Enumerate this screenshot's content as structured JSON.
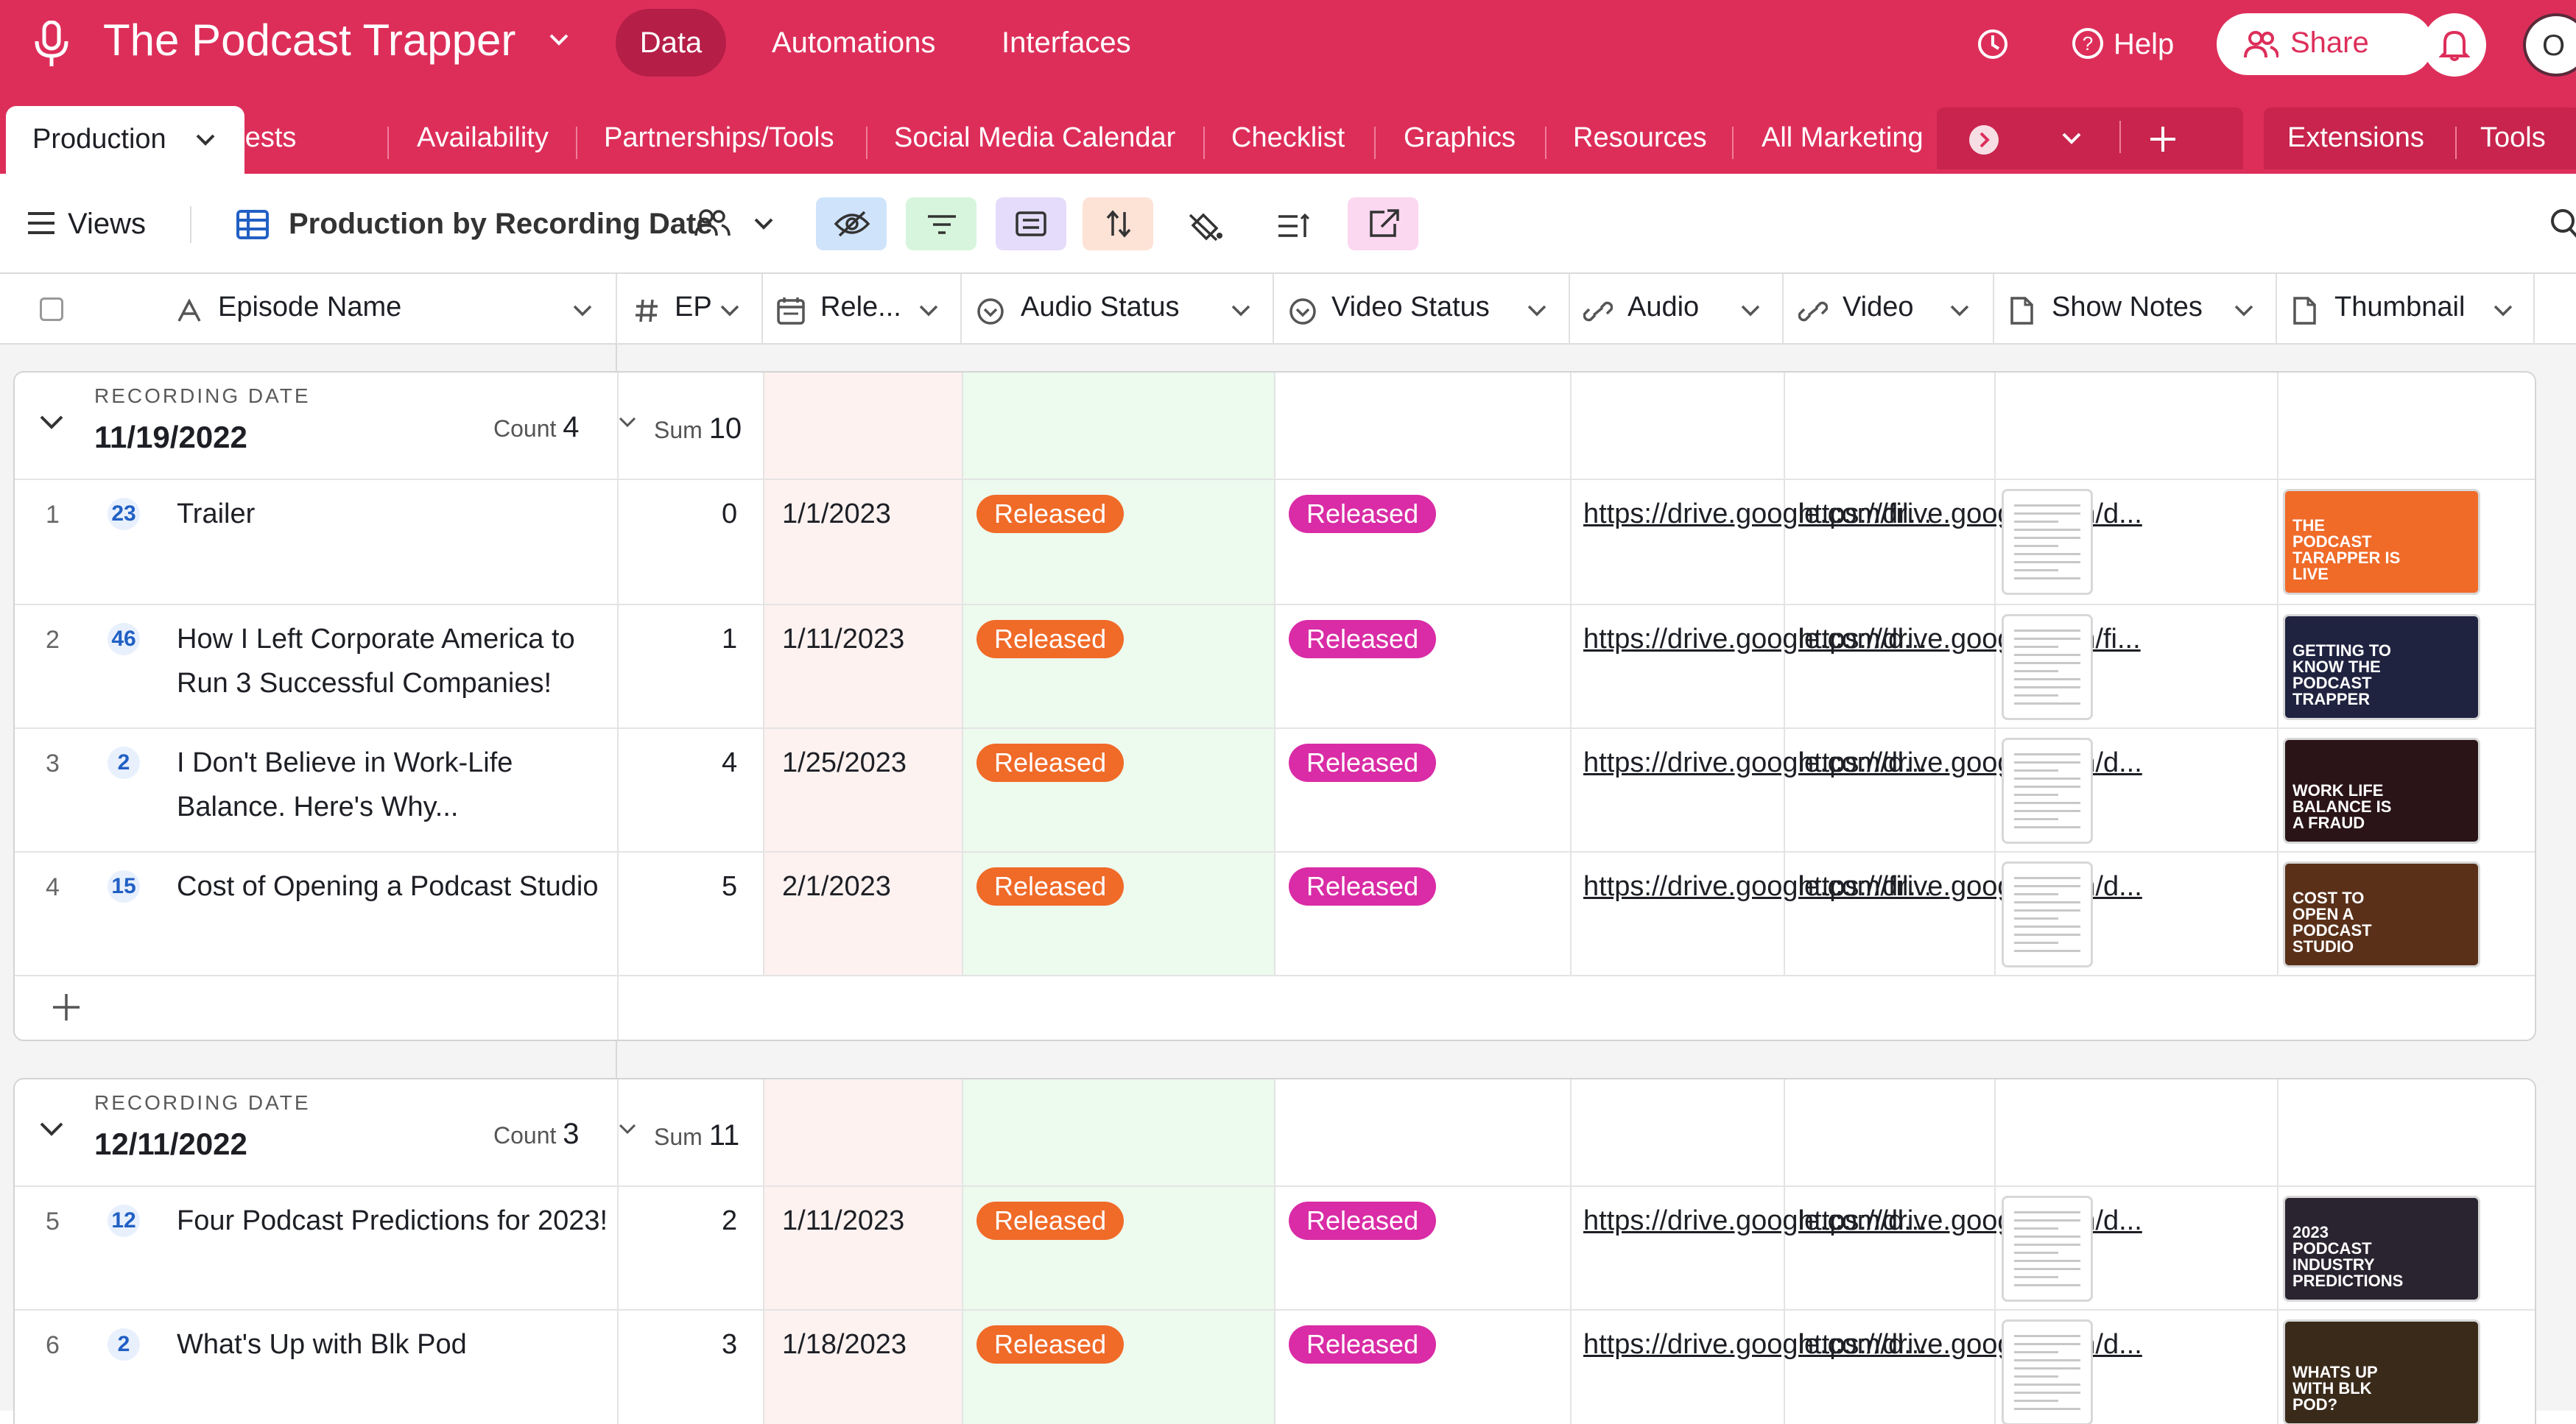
{
  "app": {
    "title": "The Podcast Trapper",
    "nav": [
      "Data",
      "Automations",
      "Interfaces"
    ],
    "help_label": "Help",
    "share_label": "Share",
    "avatar_initial": "O"
  },
  "tabs": [
    "Production",
    "Guests",
    "Availability",
    "Partnerships/Tools",
    "Social Media Calendar",
    "Checklist",
    "Graphics",
    "Resources",
    "All Marketing"
  ],
  "tab_right": [
    "Extensions",
    "Tools"
  ],
  "toolbar": {
    "views_label": "Views",
    "view_name": "Production by Recording Date",
    "colors": {
      "hide": "#cfe3fb",
      "filter": "#d7f5dc",
      "group": "#e4dcfa",
      "sort": "#fde2d6",
      "share": "#fbd7f0"
    }
  },
  "columns": [
    "Episode Name",
    "EP",
    "Rele...",
    "Audio Status",
    "Video Status",
    "Audio",
    "Video",
    "Show Notes",
    "Thumbnail"
  ],
  "groups": [
    {
      "label": "RECORDING DATE",
      "date": "11/19/2022",
      "count_label": "Count",
      "count": "4",
      "sum_label": "Sum",
      "sum": "10",
      "rows": [
        {
          "num": "1",
          "badge": "23",
          "name": "Trailer",
          "ep": "0",
          "release": "1/1/2023",
          "audio_status": "Released",
          "video_status": "Released",
          "audio": "https://drive.google.com/fil...",
          "video": "https://drive.google.com/d...",
          "thumb_text": "THE PODCAST TARAPPER IS LIVE"
        },
        {
          "num": "2",
          "badge": "46",
          "name": "How I Left Corporate America to Run 3 Successful Companies!",
          "ep": "1",
          "release": "1/11/2023",
          "audio_status": "Released",
          "video_status": "Released",
          "audio": "https://drive.google.com/d...",
          "video": "https://drive.google.com/fi...",
          "thumb_text": "GETTING TO KNOW THE PODCAST TRAPPER"
        },
        {
          "num": "3",
          "badge": "2",
          "name": "I Don't Believe in Work-Life Balance. Here's Why...",
          "ep": "4",
          "release": "1/25/2023",
          "audio_status": "Released",
          "video_status": "Released",
          "audio": "https://drive.google.com/d...",
          "video": "https://drive.google.com/d...",
          "thumb_text": "WORK LIFE BALANCE IS A FRAUD"
        },
        {
          "num": "4",
          "badge": "15",
          "name": "Cost of Opening a Podcast Studio",
          "ep": "5",
          "release": "2/1/2023",
          "audio_status": "Released",
          "video_status": "Released",
          "audio": "https://drive.google.com/fil...",
          "video": "https://drive.google.com/d...",
          "thumb_text": "COST TO OPEN A PODCAST STUDIO"
        }
      ]
    },
    {
      "label": "RECORDING DATE",
      "date": "12/11/2022",
      "count_label": "Count",
      "count": "3",
      "sum_label": "Sum",
      "sum": "11",
      "rows": [
        {
          "num": "5",
          "badge": "12",
          "name": "Four Podcast Predictions for 2023!",
          "ep": "2",
          "release": "1/11/2023",
          "audio_status": "Released",
          "video_status": "Released",
          "audio": "https://drive.google.com/d...",
          "video": "https://drive.google.com/d...",
          "thumb_text": "2023 PODCAST INDUSTRY PREDICTIONS"
        },
        {
          "num": "6",
          "badge": "2",
          "name": "What's Up with Blk Pod",
          "ep": "3",
          "release": "1/18/2023",
          "audio_status": "Released",
          "video_status": "Released",
          "audio": "https://drive.google.com/d...",
          "video": "https://drive.google.com/d...",
          "thumb_text": "WHATS UP WITH BLK POD?"
        }
      ]
    }
  ]
}
